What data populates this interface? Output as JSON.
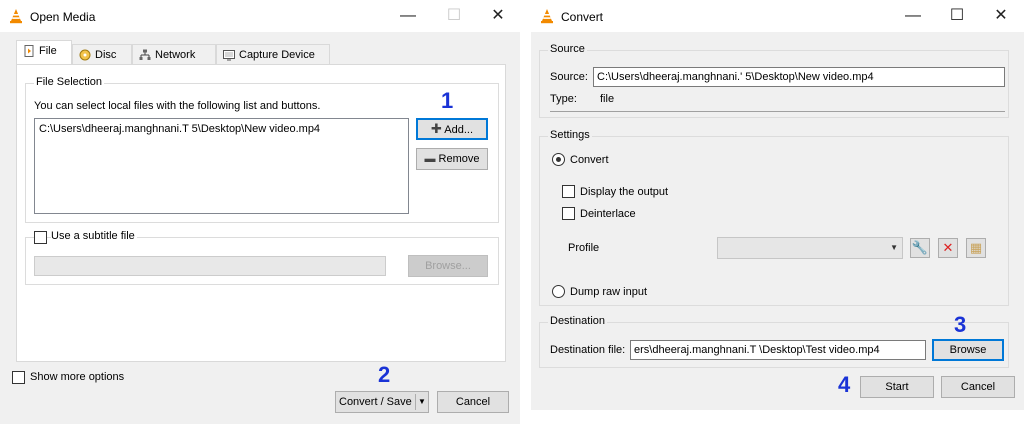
{
  "open_media": {
    "title": "Open Media",
    "tabs": [
      {
        "label": "File",
        "icon": "file-icon"
      },
      {
        "label": "Disc",
        "icon": "disc-icon"
      },
      {
        "label": "Network",
        "icon": "network-icon"
      },
      {
        "label": "Capture Device",
        "icon": "capture-device-icon"
      }
    ],
    "file_selection": {
      "title": "File Selection",
      "hint": "You can select local files with the following list and buttons.",
      "files": [
        "C:\\Users\\dheeraj.manghnani.T              5\\Desktop\\New video.mp4"
      ],
      "add_label": "Add...",
      "remove_label": "Remove"
    },
    "subtitle": {
      "checkbox_label": "Use a subtitle file",
      "browse_label": "Browse..."
    },
    "show_more_label": "Show more options",
    "convert_save_label": "Convert / Save",
    "cancel_label": "Cancel"
  },
  "convert": {
    "title": "Convert",
    "source": {
      "group_title": "Source",
      "source_label": "Source:",
      "source_value": "C:\\Users\\dheeraj.manghnani.'              5\\Desktop\\New video.mp4",
      "type_label": "Type:",
      "type_value": "file"
    },
    "settings": {
      "group_title": "Settings",
      "convert_label": "Convert",
      "display_output_label": "Display the output",
      "deinterlace_label": "Deinterlace",
      "profile_label": "Profile",
      "dump_raw_label": "Dump raw input"
    },
    "destination": {
      "group_title": "Destination",
      "file_label": "Destination file:",
      "file_value": "ers\\dheeraj.manghnani.T              \\Desktop\\Test video.mp4",
      "browse_label": "Browse"
    },
    "start_label": "Start",
    "cancel_label": "Cancel"
  },
  "steps": [
    "1",
    "2",
    "3",
    "4"
  ],
  "colors": {
    "step_annotation": "#1a33d6",
    "focus": "#0078d7",
    "vlc_orange": "#f28a00"
  }
}
